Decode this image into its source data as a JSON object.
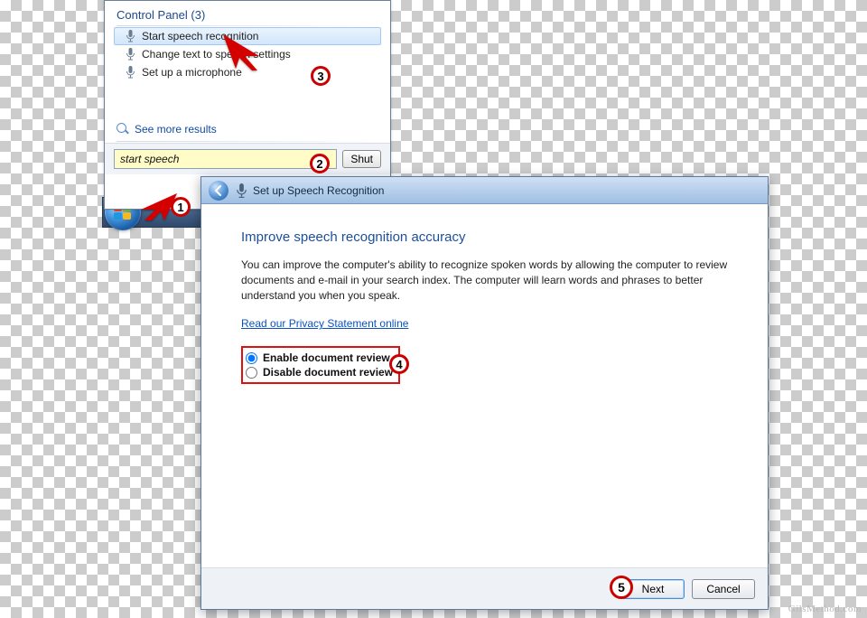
{
  "start_menu": {
    "header": "Control Panel (3)",
    "items": [
      {
        "label": "Start speech recognition"
      },
      {
        "label": "Change text to speech settings"
      },
      {
        "label": "Set up a microphone"
      }
    ],
    "see_more": "See more results",
    "search_value": "start speech",
    "shutdown_label": "Shut"
  },
  "wizard": {
    "title": "Set up Speech Recognition",
    "heading": "Improve speech recognition accuracy",
    "body": "You can improve the computer's ability to recognize spoken words by allowing the computer to review documents and e-mail in your search index. The computer will learn words and phrases to better understand you when you speak.",
    "privacy_link": "Read our Privacy Statement online",
    "options": {
      "enable": "Enable document review",
      "disable": "Disable document review",
      "selected": "enable"
    },
    "buttons": {
      "next": "Next",
      "cancel": "Cancel"
    }
  },
  "callouts": {
    "c1": "1",
    "c2": "2",
    "c3": "3",
    "c4": "4",
    "c5": "5"
  },
  "watermark": "GilsMethod.com"
}
